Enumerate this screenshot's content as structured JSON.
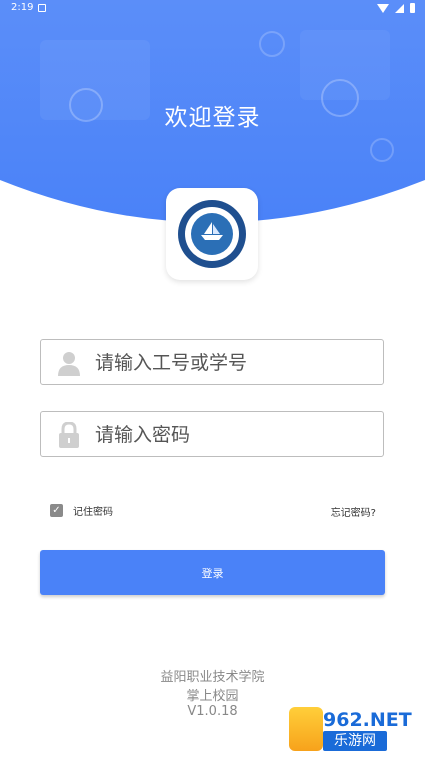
{
  "status_bar": {
    "time": "2:19"
  },
  "header": {
    "title": "欢迎登录",
    "background_color": "#4a82f8"
  },
  "form": {
    "username_placeholder": "请输入工号或学号",
    "password_placeholder": "请输入密码",
    "remember_label": "记住密码",
    "remember_checked": true,
    "forgot_label": "忘记密码?",
    "login_label": "登录"
  },
  "footer": {
    "school": "益阳职业技术学院",
    "app_name": "掌上校园",
    "version": "V1.0.18"
  },
  "watermark": {
    "brand": "962.NET",
    "sub": "乐游网"
  },
  "colors": {
    "accent": "#4a82f8",
    "input_border": "#bdbdbd",
    "footer_text": "#888888"
  }
}
